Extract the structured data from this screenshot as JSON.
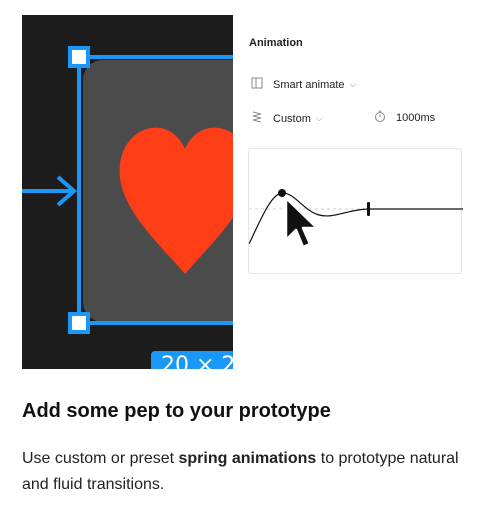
{
  "illustration": {
    "size_badge": "20 × 2",
    "colors": {
      "canvas": "#1c1c1c",
      "frame": "#4b4b4b",
      "heart": "#ff3d17",
      "selection": "#1a98f7"
    }
  },
  "panel": {
    "title": "Animation",
    "animation_type": {
      "icon": "frame-icon",
      "label": "Smart animate"
    },
    "easing": {
      "icon": "spring-icon",
      "label": "Custom"
    },
    "duration": {
      "icon": "timer-icon",
      "value": "1000ms"
    }
  },
  "content": {
    "heading": "Add some pep to your prototype",
    "desc_prefix": "Use custom or preset ",
    "desc_bold": "spring animations",
    "desc_suffix": " to prototype natural and fluid transitions."
  }
}
